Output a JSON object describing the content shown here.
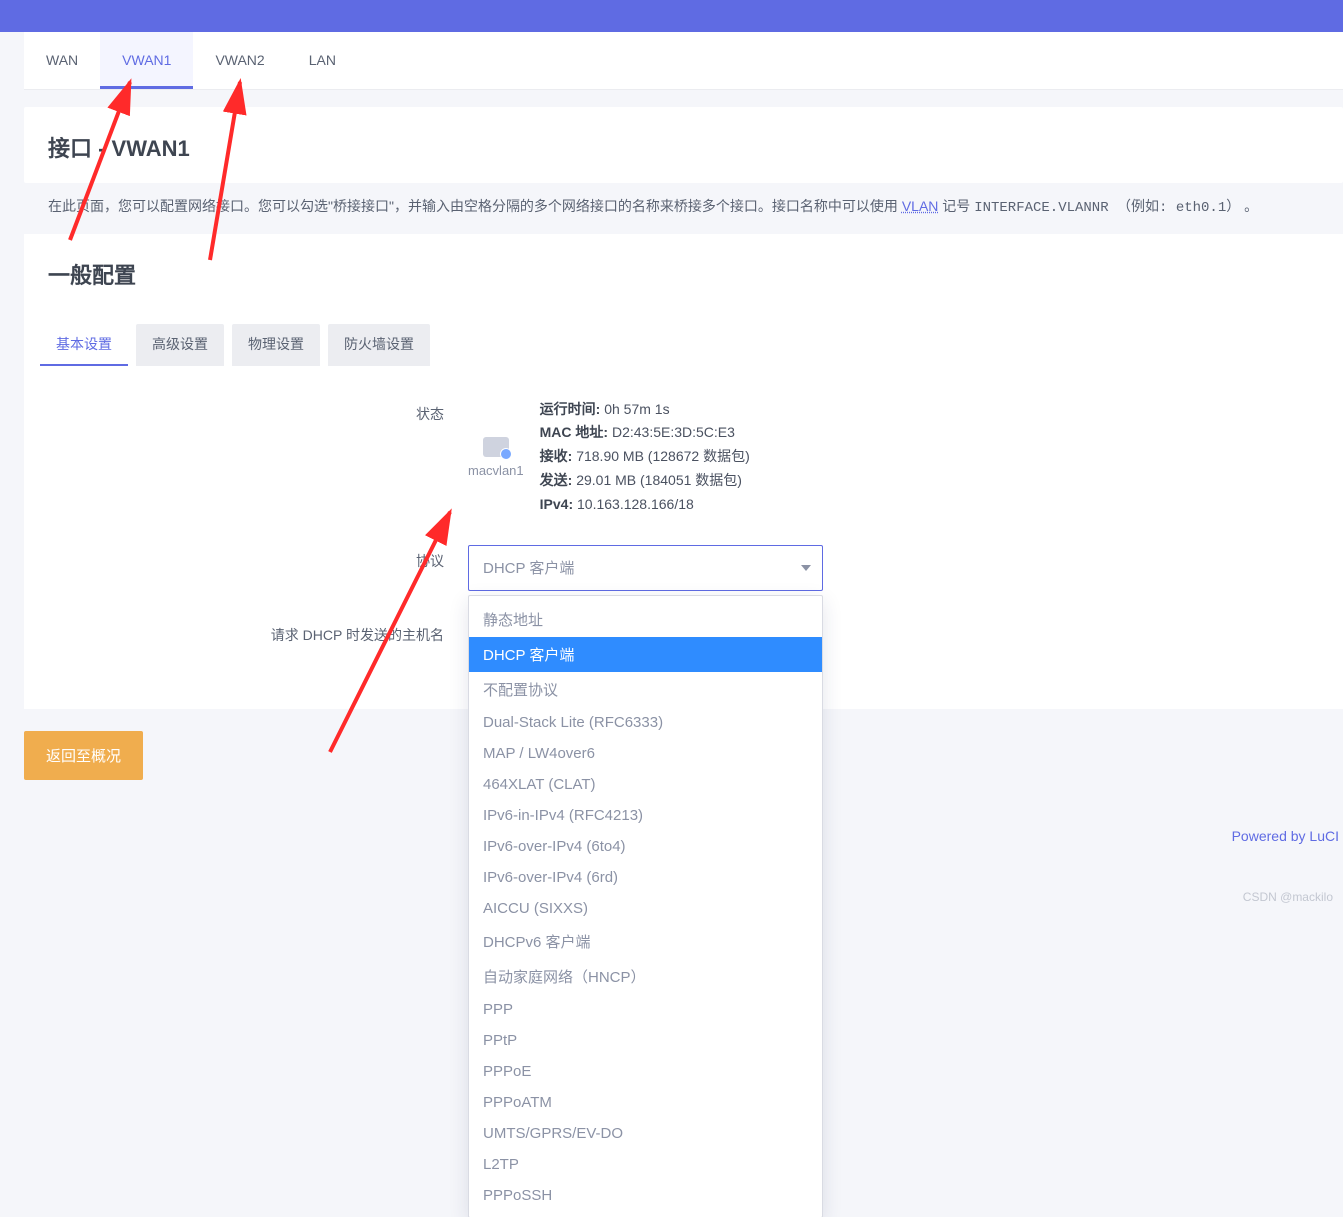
{
  "tabs": {
    "items": [
      "WAN",
      "VWAN1",
      "VWAN2",
      "LAN"
    ],
    "activeIndex": 1
  },
  "panel": {
    "title": "接口 - VWAN1"
  },
  "description": {
    "part1": "在此页面，您可以配置网络接口。您可以勾选\"桥接接口\"，并输入由空格分隔的多个网络接口的名称来桥接多个接口。接口名称中可以使用 ",
    "vlan": "VLAN",
    "part2": " 记号 ",
    "mono": "INTERFACE.VLANNR （例如: eth0.1）",
    "part3": " 。"
  },
  "sectionTitle": "一般配置",
  "subtabs": {
    "items": [
      "基本设置",
      "高级设置",
      "物理设置",
      "防火墙设置"
    ],
    "activeIndex": 0
  },
  "status": {
    "label": "状态",
    "ifaceName": "macvlan1",
    "uptime": {
      "k": "运行时间:",
      "v": "0h 57m 1s"
    },
    "mac": {
      "k": "MAC 地址:",
      "v": "D2:43:5E:3D:5C:E3"
    },
    "rx": {
      "k": "接收:",
      "v": "718.90 MB (128672 数据包)"
    },
    "tx": {
      "k": "发送:",
      "v": "29.01 MB (184051 数据包)"
    },
    "ipv4": {
      "k": "IPv4:",
      "v": "10.163.128.166/18"
    }
  },
  "protocol": {
    "label": "协议",
    "selected": "DHCP 客户端",
    "options": [
      "静态地址",
      "DHCP 客户端",
      "不配置协议",
      "Dual-Stack Lite (RFC6333)",
      "MAP / LW4over6",
      "464XLAT (CLAT)",
      "IPv6-in-IPv4 (RFC4213)",
      "IPv6-over-IPv4 (6to4)",
      "IPv6-over-IPv4 (6rd)",
      "AICCU (SIXXS)",
      "DHCPv6 客户端",
      "自动家庭网络（HNCP）",
      "PPP",
      "PPtP",
      "PPPoE",
      "PPPoATM",
      "UMTS/GPRS/EV-DO",
      "L2TP",
      "PPPoSSH"
    ],
    "selectedIndex": 1
  },
  "hostname": {
    "label": "请求 DHCP 时发送的主机名",
    "value": ""
  },
  "buttons": {
    "back": "返回至概况"
  },
  "footer": {
    "powered": "Powered by LuCI"
  },
  "watermark": "CSDN @mackilo"
}
